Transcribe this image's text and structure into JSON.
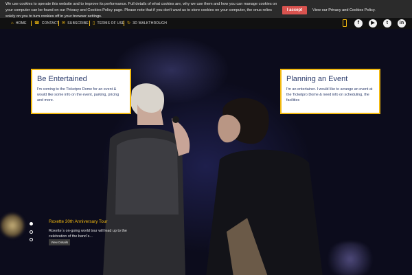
{
  "cookie": {
    "message": "We use cookies to operate this website and to improve its performance. Full details of what cookies are, why we use them and how you can manage cookies on your computer can be found on our Privacy and Cookies Policy page. Please note that if you don't want us to store cookies on your computer, the onus relies solely on you to turn cookies off in your browser settings.",
    "accept_label": "I accept",
    "policy_link": "View our Privacy and Cookies Policy."
  },
  "nav": {
    "items": [
      {
        "label": "HOME",
        "icon": "home-icon"
      },
      {
        "label": "CONTACT",
        "icon": "phone-icon"
      },
      {
        "label": "SUBSCRIBE",
        "icon": "envelope-icon"
      },
      {
        "label": "TERMS OF USE",
        "icon": "document-icon"
      },
      {
        "label": "3D WALKTHROUGH",
        "icon": "refresh-icon"
      }
    ],
    "social": [
      {
        "name": "facebook-icon",
        "glyph": "f"
      },
      {
        "name": "youtube-icon",
        "glyph": "▶"
      },
      {
        "name": "twitter-icon",
        "glyph": "t"
      },
      {
        "name": "linkedin-icon",
        "glyph": "in"
      }
    ]
  },
  "cards": {
    "entertained": {
      "title": "Be Entertained",
      "text": "I'm coming to the Ticketpro Dome for an event & would like some info on the event, parking, pricing and more."
    },
    "planning": {
      "title": "Planning an Event",
      "text": "I'm an entertainer. I would like to arrange an event at the Ticketpro Dome & need info on scheduling, the facilities"
    }
  },
  "slider": {
    "title": "Roxette 30th Anniversary Tour",
    "text": "Roxette`s on-going world tour will lead up to the celebration of the band`s...",
    "button": "View Details",
    "active_index": 0,
    "slide_count": 3
  },
  "colors": {
    "accent": "#f2b90f",
    "accept": "#d9534f",
    "card_text": "#2a3a6a"
  }
}
